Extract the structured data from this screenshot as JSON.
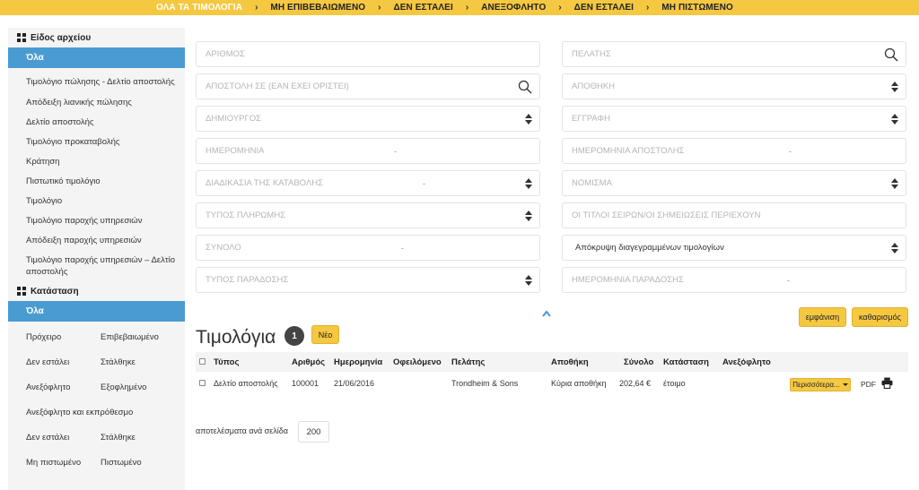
{
  "topnav": {
    "items": [
      "ΟΛΑ ΤΑ ΤΙΜΟΛΟΓΙΑ",
      "ΜΗ ΕΠΙΒΕΒΑΙΩΜΕΝΟ",
      "ΔΕΝ ΕΣΤΑΛΕΙ",
      "ΑΝΕΞΟΦΛΗΤΟ",
      "ΔΕΝ ΕΣΤΑΛΕΙ",
      "ΜΗ ΠΙΣΤΩΜΕΝΟ"
    ],
    "separator": "›"
  },
  "sidebar": {
    "type_heading": "Είδος αρχείου",
    "type_active": "Όλα",
    "types": [
      "Τιμολόγιο πώλησης - Δελτίο αποστολής",
      "Απόδειξη λιανικής πώλησης",
      "Δελτίο αποστολής",
      "Τιμολόγιο προκαταβολής",
      "Κράτηση",
      "Πιστωτικό τιμολόγιο",
      "Τιμολόγιο",
      "Τιμολόγιο παροχής υπηρεσιών",
      "Απόδειξη παροχής υπηρεσιών",
      "Τιμολόγιο παροχής υπηρεσιών – Δελτίο αποστολής"
    ],
    "status_heading": "Κατάσταση",
    "status_active": "Όλα",
    "status": {
      "draft": "Πρόχειρο",
      "confirmed": "Επιβεβαιωμένο",
      "not_sent_1": "Δεν εστάλει",
      "sent_1": "Στάλθηκε",
      "unpaid": "Ανεξόφλητο",
      "paid": "Εξοφλημένο",
      "unpaid_overdue": "Ανεξόφλητο και εκπρόθεσμο",
      "not_sent_2": "Δεν εστάλει",
      "sent_2": "Στάλθηκε",
      "not_credited": "Μη πιστωμένο",
      "credited": "Πιστωμένο"
    }
  },
  "filters": {
    "number": "ΑΡΙΘΜΟΣ",
    "customer": "ΠΕΛΑΤΗΣ",
    "ship_to": "ΑΠΟΣΤΟΛΗ ΣΕ (ΕΑΝ ΕΧΕΙ ΟΡΙΣΤΕΙ)",
    "warehouse": "ΑΠΟΘΗΚΗ",
    "creator": "ΔΗΜΙΟΥΡΓΟΣ",
    "record": "ΕΓΓΡΑΦΗ",
    "date": "ΗΜΕΡΟΜΗΝΙΑ",
    "ship_date": "ΗΜΕΡΟΜΗΝΙΑ ΑΠΟΣΤΟΛΗΣ",
    "payment_procedure": "ΔΙΑΔΙΚΑΣΙΑ ΤΗΣ ΚΑΤΑΒΟΛΗΣ",
    "currency": "ΝΟΜΙΣΜΑ",
    "payment_type": "ΤΥΠΟΣ ΠΛΗΡΩΜΗΣ",
    "titles_notes": "ΟΙ ΤΙΤΛΟΙ ΣΕΙΡΩΝ/ΟΙ ΣΗΜΕΙΩΣΕΙΣ ΠΕΡΙΕΧΟΥΝ",
    "total": "ΣΥΝΟΛΟ",
    "hide_deleted": "Απόκρυψη διαγεγραμμένων τιμολογίων",
    "delivery_type": "ΤΥΠΟΣ ΠΑΡΑΔΟΣΗΣ",
    "delivery_date": "ΗΜΕΡΟΜΗΝΙΑ ΠΑΡΑΔΟΣΗΣ",
    "range_dash": "-",
    "show_label": "εμφάνιση",
    "clear_label": "καθαρισμός"
  },
  "list": {
    "title": "Τιμολόγια",
    "count": "1",
    "new_label": "Νέο",
    "columns": {
      "type": "Τύπος",
      "number": "Αριθμός",
      "date": "Ημερομηνία",
      "owed": "Οφειλόμενο",
      "customer": "Πελάτης",
      "warehouse": "Αποθήκη",
      "total": "Σύνολο",
      "status": "Κατάσταση",
      "unpaid": "Ανεξόφλητο"
    },
    "rows": [
      {
        "type": "Δελτίο αποστολής",
        "number": "100001",
        "date": "21/06/2016",
        "customer": "Trondheim & Sons",
        "warehouse": "Κύρια αποθήκη",
        "total": "202,64 €",
        "status": "έτοιμο",
        "more_label": "Περισσότερα...",
        "pdf_label": "PDF"
      }
    ],
    "per_page_label": "αποτελέσματα ανά σελίδα",
    "per_page_value": "200"
  }
}
